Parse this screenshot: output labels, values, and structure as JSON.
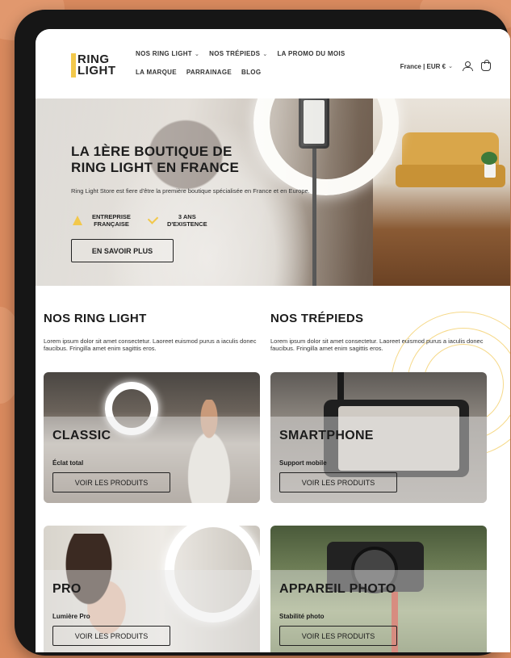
{
  "header": {
    "logo_line1": "RING",
    "logo_line2": "LIGHT",
    "nav_row1": [
      "NOS RING LIGHT",
      "NOS TRÉPIEDS",
      "LA PROMO DU MOIS"
    ],
    "nav_row2": [
      "LA MARQUE",
      "PARRAINAGE",
      "BLOG"
    ],
    "locale": "France | EUR €",
    "account_icon": "user-icon",
    "cart_icon": "bag-icon"
  },
  "hero": {
    "title": "LA 1ÈRE BOUTIQUE DE RING LIGHT EN FRANCE",
    "description": "Ring Light Store est fiere d'être la première boutique spécialisée en France et en Europe.",
    "feature1_line1": "ENTREPRISE",
    "feature1_line2": "FRANÇAISE",
    "feature2_line1": "3 ANS",
    "feature2_line2": "D'EXISTENCE",
    "cta": "EN SAVOIR PLUS"
  },
  "sections": {
    "ring_title": "NOS RING LIGHT",
    "ring_desc": "Lorem ipsum dolor sit amet consectetur. Laoreet euismod purus a iaculis donec faucibus. Fringilla amet enim sagittis eros.",
    "tripod_title": "NOS TRÉPIEDS",
    "tripod_desc": "Lorem ipsum dolor sit amet consectetur. Laoreet euismod purus a iaculis donec faucibus. Fringilla amet enim sagittis eros."
  },
  "cards": [
    {
      "title": "CLASSIC",
      "subtitle": "Éclat total",
      "button": "VOIR LES PRODUITS"
    },
    {
      "title": "SMARTPHONE",
      "subtitle": "Support mobile",
      "button": "VOIR LES PRODUITS"
    },
    {
      "title": "PRO",
      "subtitle": "Lumière Pro",
      "button": "VOIR LES PRODUITS"
    },
    {
      "title": "APPAREIL PHOTO",
      "subtitle": "Stabilité photo",
      "button": "VOIR LES PRODUITS"
    }
  ],
  "colors": {
    "background": "#d98a5e",
    "accent": "#f2c84b",
    "text": "#1c1c1c"
  }
}
